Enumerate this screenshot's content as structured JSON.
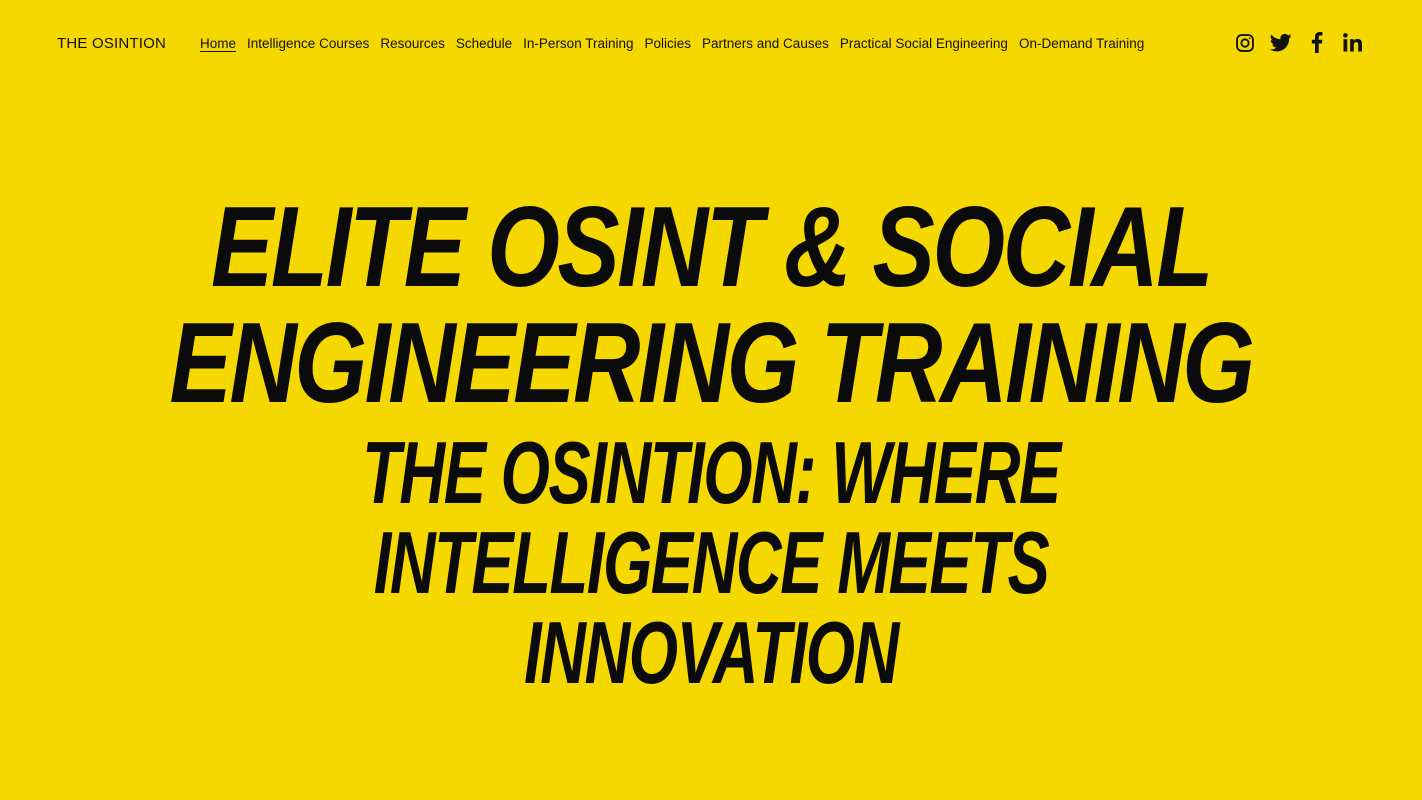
{
  "header": {
    "site_title": "THE OSINTION",
    "nav": [
      {
        "label": "Home",
        "active": true
      },
      {
        "label": "Intelligence Courses",
        "active": false
      },
      {
        "label": "Resources",
        "active": false
      },
      {
        "label": "Schedule",
        "active": false
      },
      {
        "label": "In-Person Training",
        "active": false
      },
      {
        "label": "Policies",
        "active": false
      },
      {
        "label": "Partners and Causes",
        "active": false
      },
      {
        "label": "Practical Social Engineering",
        "active": false
      },
      {
        "label": "On-Demand Training",
        "active": false
      }
    ],
    "social_icons": [
      "instagram-icon",
      "twitter-icon",
      "facebook-icon",
      "linkedin-icon"
    ]
  },
  "hero": {
    "headline_lines": [
      "ELITE OSINT & SOCIAL",
      "ENGINEERING TRAINING"
    ],
    "subhead_lines": [
      "THE OSINTION: WHERE",
      "INTELLIGENCE MEETS",
      "INNOVATION"
    ]
  },
  "colors": {
    "background": "#f5d800",
    "text": "#0b0b0b"
  }
}
